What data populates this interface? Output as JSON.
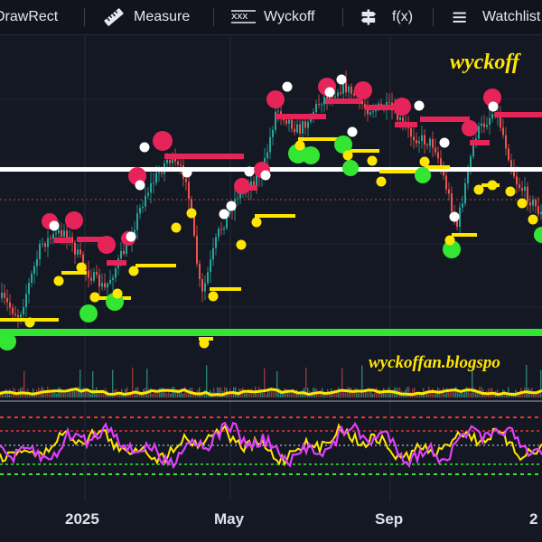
{
  "toolbar": {
    "items": [
      {
        "label": "DrawRect",
        "icon": "draw-rect-icon"
      },
      {
        "label": "Measure",
        "icon": "ruler-icon"
      },
      {
        "label": "Wyckoff",
        "icon": "wyckoff-icon"
      },
      {
        "label": "f(x)",
        "icon": "function-icon"
      },
      {
        "label": "Watchlist",
        "icon": "list-icon"
      }
    ]
  },
  "watermarks": {
    "top": "wyckoff",
    "middle": "wyckoffan.blogspo"
  },
  "x_axis": {
    "labels": [
      "2025",
      "May",
      "Sep",
      "2"
    ]
  },
  "colors": {
    "background": "#141823",
    "up_candle": "#26a69a",
    "down_candle": "#ef5350",
    "resistance_line": "#ffffff",
    "support_line": "#33e633",
    "upper_markers": "#e6245a",
    "lower_markers": "#ffe600",
    "green_markers": "#33e633",
    "oscillator_1": "#e040fb",
    "oscillator_2": "#ffe600"
  }
}
